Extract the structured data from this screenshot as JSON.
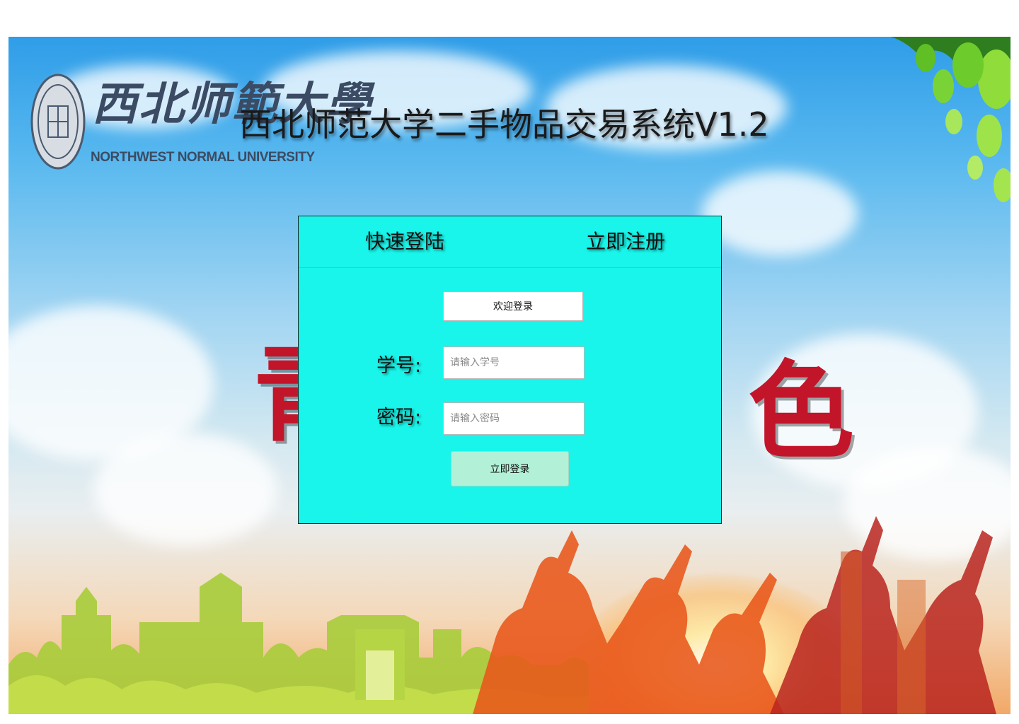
{
  "page": {
    "title": "西北师范大学二手物品交易系统V1.2"
  },
  "logo": {
    "script_text": "西北师範大學",
    "english_name": "NORTHWEST NORMAL UNIVERSITY"
  },
  "background": {
    "banner_left_char": "青",
    "banner_right_char": "色"
  },
  "login": {
    "tabs": [
      {
        "label": "快速登陆",
        "active": true
      },
      {
        "label": "立即注册",
        "active": false
      }
    ],
    "welcome_label": "欢迎登录",
    "student_id": {
      "label": "学号:",
      "placeholder": "请输入学号",
      "value": ""
    },
    "password": {
      "label": "密码:",
      "placeholder": "请输入密码",
      "value": ""
    },
    "submit_label": "立即登录"
  },
  "colors": {
    "panel_bg": "#19f5ea",
    "submit_bg": "#b2f1d8",
    "banner_red": "#c3152a"
  }
}
